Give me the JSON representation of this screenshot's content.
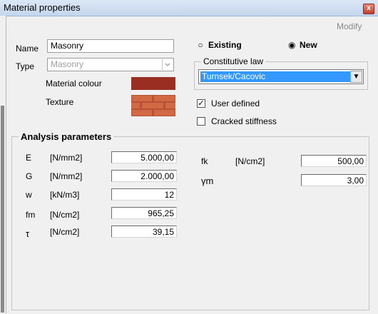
{
  "window": {
    "title": "Material properties",
    "close_symbol": "x"
  },
  "header": {
    "modify_label": "Modify"
  },
  "material": {
    "name_label": "Name",
    "name_value": "Masonry",
    "type_label": "Type",
    "type_value": "Masonry",
    "colour_label": "Material colour",
    "colour_value": "#9b2e22",
    "texture_label": "Texture"
  },
  "mode": {
    "existing_label": "Existing",
    "new_label": "New",
    "selected": "New"
  },
  "constitutive": {
    "group_label": "Constitutive law",
    "selected": "Turnsek/Cacovic",
    "arrow": "▼"
  },
  "options": {
    "user_defined_label": "User defined",
    "user_defined_checked": true,
    "cracked_label": "Cracked stiffness",
    "cracked_checked": false,
    "check_mark": "✓"
  },
  "analysis": {
    "group_label": "Analysis parameters",
    "left": [
      {
        "symbol": "E",
        "unit": "[N/mm2]",
        "value": "5.000,00"
      },
      {
        "symbol": "G",
        "unit": "[N/mm2]",
        "value": "2.000,00"
      },
      {
        "symbol": "w",
        "unit": "[kN/m3]",
        "value": "12"
      },
      {
        "symbol": "fm",
        "unit": "[N/cm2]",
        "value": "965,25"
      },
      {
        "symbol": "τ",
        "unit": "[N/cm2]",
        "value": "39,15"
      }
    ],
    "right": [
      {
        "symbol": "fk",
        "unit": "[N/cm2]",
        "value": "500,00"
      },
      {
        "symbol": "γm",
        "unit": "",
        "value": "3,00"
      }
    ]
  }
}
